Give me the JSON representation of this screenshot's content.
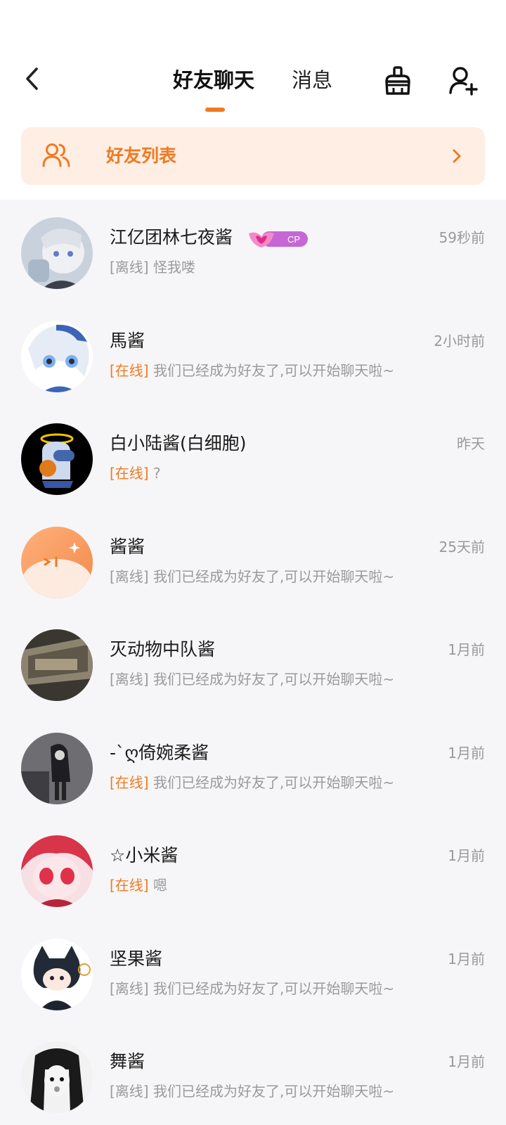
{
  "header": {
    "tabs": [
      {
        "label": "好友聊天",
        "active": true
      },
      {
        "label": "消息",
        "active": false
      }
    ],
    "accent_color": "#f07a22"
  },
  "friend_list_banner": {
    "label": "好友列表",
    "icon": "users-icon",
    "chevron": "chevron-right-icon"
  },
  "cp_badge_text": "CP",
  "chats": [
    {
      "name": "江亿团林七夜酱",
      "time": "59秒前",
      "status": "[离线]",
      "online": false,
      "message": "怪我喽"
    },
    {
      "name": "馬酱",
      "time": "2小时前",
      "status": "[在线]",
      "online": true,
      "message": "我们已经成为好友了,可以开始聊天啦~"
    },
    {
      "name": "白小陆酱(白细胞)",
      "time": "昨天",
      "status": "[在线]",
      "online": true,
      "message": "?"
    },
    {
      "name": "酱酱",
      "time": "25天前",
      "status": "[离线]",
      "online": false,
      "message": "我们已经成为好友了,可以开始聊天啦~"
    },
    {
      "name": "灭动物中队酱",
      "time": "1月前",
      "status": "[离线]",
      "online": false,
      "message": "我们已经成为好友了,可以开始聊天啦~"
    },
    {
      "name": "-`ღ倚婉柔酱",
      "time": "1月前",
      "status": "[在线]",
      "online": true,
      "message": "我们已经成为好友了,可以开始聊天啦~"
    },
    {
      "name": "☆小米酱",
      "time": "1月前",
      "status": "[在线]",
      "online": true,
      "message": "嗯"
    },
    {
      "name": "坚果酱",
      "time": "1月前",
      "status": "[离线]",
      "online": false,
      "message": "我们已经成为好友了,可以开始聊天啦~"
    },
    {
      "name": "舞酱",
      "time": "1月前",
      "status": "[离线]",
      "online": false,
      "message": "我们已经成为好友了,可以开始聊天啦~"
    }
  ]
}
